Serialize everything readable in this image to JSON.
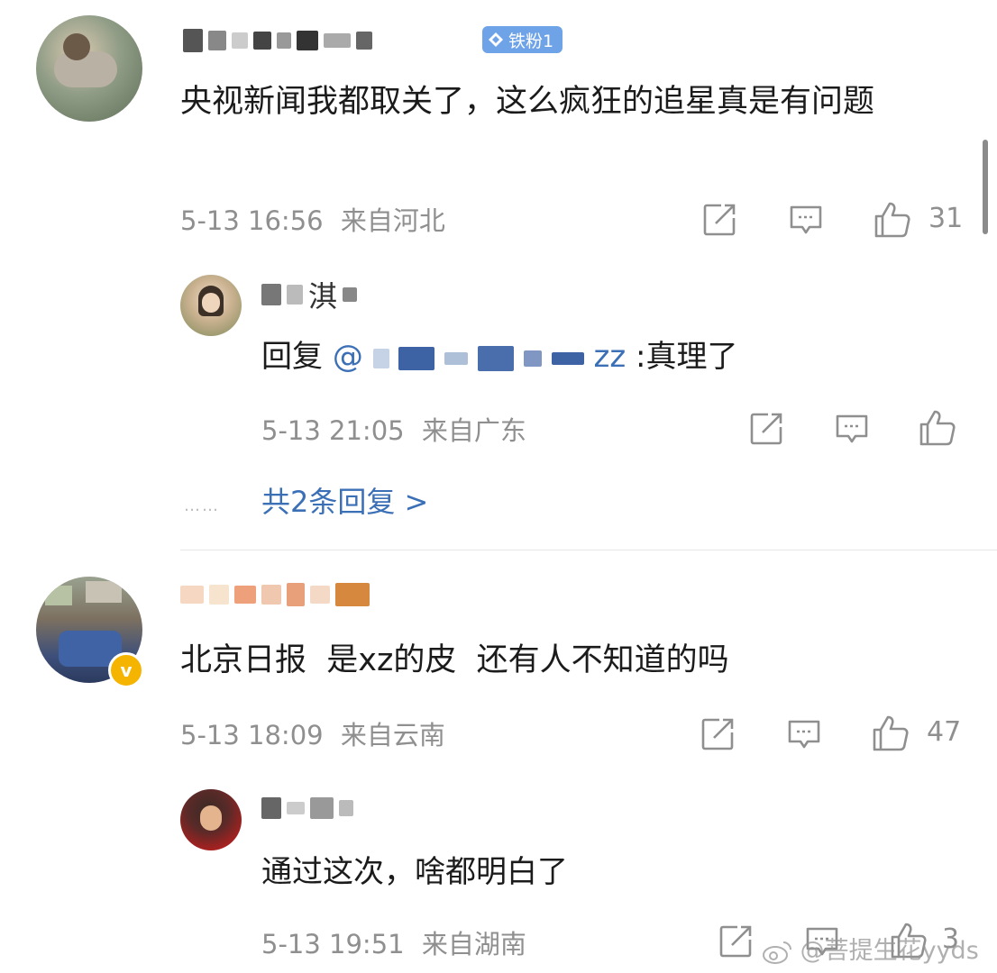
{
  "comments": [
    {
      "badge": "铁粉1",
      "text": "央视新闻我都取关了，这么疯狂的追星真是有问题",
      "time": "5-13 16:56",
      "location": "来自河北",
      "likes": "31",
      "replies": [
        {
          "name_visible": "淇",
          "reply_prefix": "回复",
          "mention": "@",
          "mention_suffix": "zz",
          "text": ":真理了",
          "time": "5-13 21:05",
          "location": "来自广东"
        }
      ],
      "more_replies": "共2条回复 >"
    },
    {
      "text": "北京日报  是xz的皮  还有人不知道的吗",
      "time": "5-13 18:09",
      "location": "来自云南",
      "likes": "47",
      "verified_icon": "v-badge-icon",
      "replies": [
        {
          "text": "通过这次，啥都明白了",
          "time": "5-13 19:51",
          "location": "来自湖南",
          "likes": "3"
        }
      ]
    }
  ],
  "watermark": "@菩提生花yyds",
  "icons": [
    "repost-icon",
    "comment-icon",
    "like-icon",
    "diamond-icon",
    "weibo-logo-icon"
  ],
  "colors": {
    "link": "#3b6fb6",
    "meta": "#8f8f8f",
    "badge": "#6fa3e8",
    "verified": "#f5b400"
  }
}
